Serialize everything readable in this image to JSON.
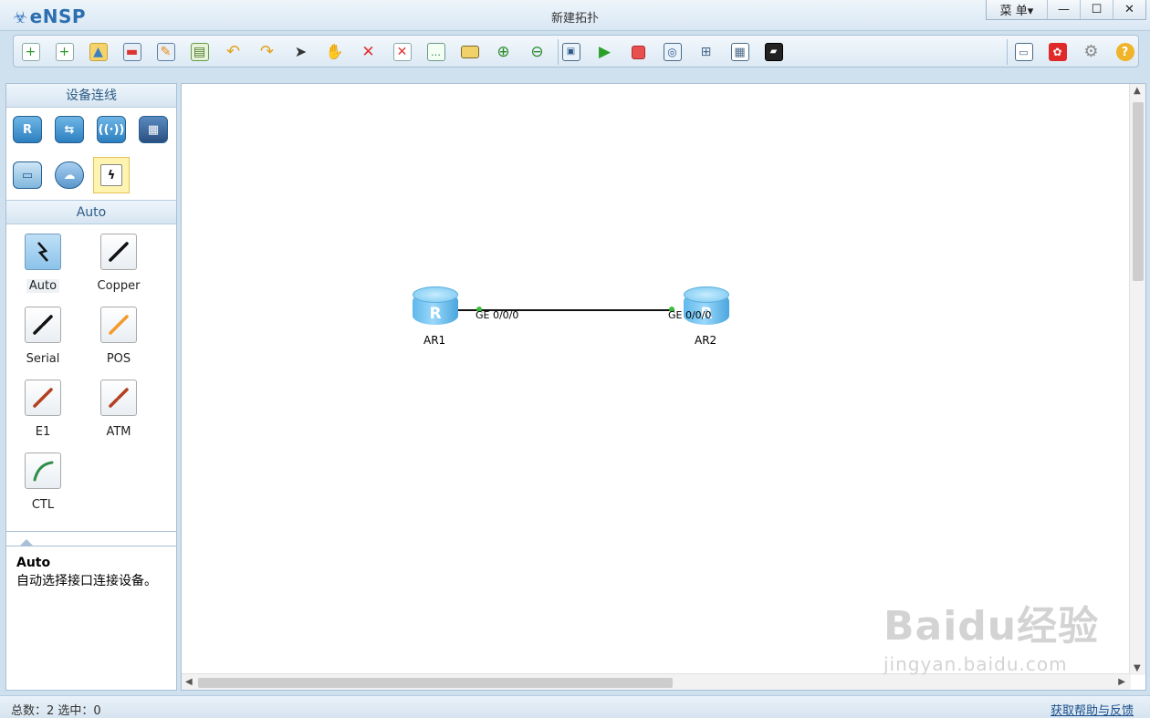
{
  "app": {
    "logo": "eNSP",
    "window_title": "新建拓扑"
  },
  "window_controls": {
    "menu": "菜 单▾",
    "minimize": "—",
    "maximize": "☐",
    "close": "✕"
  },
  "toolbar": {
    "left_icons": [
      "new-topology-icon",
      "new-example-icon",
      "open-icon",
      "save-icon",
      "save-as-icon",
      "print-icon",
      "undo-icon",
      "redo-icon",
      "select-icon",
      "pan-hand-icon",
      "delete-icon",
      "delete-links-icon",
      "text-note-icon",
      "rectangle-icon",
      "zoom-in-icon",
      "zoom-out-icon",
      "fit-window-icon",
      "start-device-icon",
      "stop-device-icon",
      "capture-icon",
      "topology-icon",
      "grid-icon",
      "cli-icon"
    ],
    "right_icons": [
      "chat-icon",
      "huawei-icon",
      "settings-icon",
      "help-icon"
    ]
  },
  "left_panel": {
    "device_header": "设备连线",
    "devices": [
      "router-icon",
      "switch-icon",
      "wlan-icon",
      "firewall-icon",
      "pc-icon",
      "cloud-icon",
      "connection-icon"
    ],
    "cable_header": "Auto",
    "cables": [
      {
        "label": "Auto",
        "icon": "auto-cable-icon",
        "color": "#111111"
      },
      {
        "label": "Copper",
        "icon": "copper-cable-icon",
        "color": "#111111"
      },
      {
        "label": "Serial",
        "icon": "serial-cable-icon",
        "color": "#111111"
      },
      {
        "label": "POS",
        "icon": "pos-cable-icon",
        "color": "#f39a2b"
      },
      {
        "label": "E1",
        "icon": "e1-cable-icon",
        "color": "#b3401e"
      },
      {
        "label": "ATM",
        "icon": "atm-cable-icon",
        "color": "#b3401e"
      },
      {
        "label": "CTL",
        "icon": "ctl-cable-icon",
        "color": "#2f8f4a"
      }
    ],
    "desc_title": "Auto",
    "desc_text": "自动选择接口连接设备。"
  },
  "topology": {
    "nodes": [
      {
        "name": "AR1",
        "port": "GE 0/0/0"
      },
      {
        "name": "AR2",
        "port": "GE 0/0/0"
      }
    ]
  },
  "status": {
    "left": "总数：2  选中：0",
    "right": "获取帮助与反馈"
  },
  "watermark": {
    "brand": "Baidu经验",
    "url": "jingyan.baidu.com"
  }
}
